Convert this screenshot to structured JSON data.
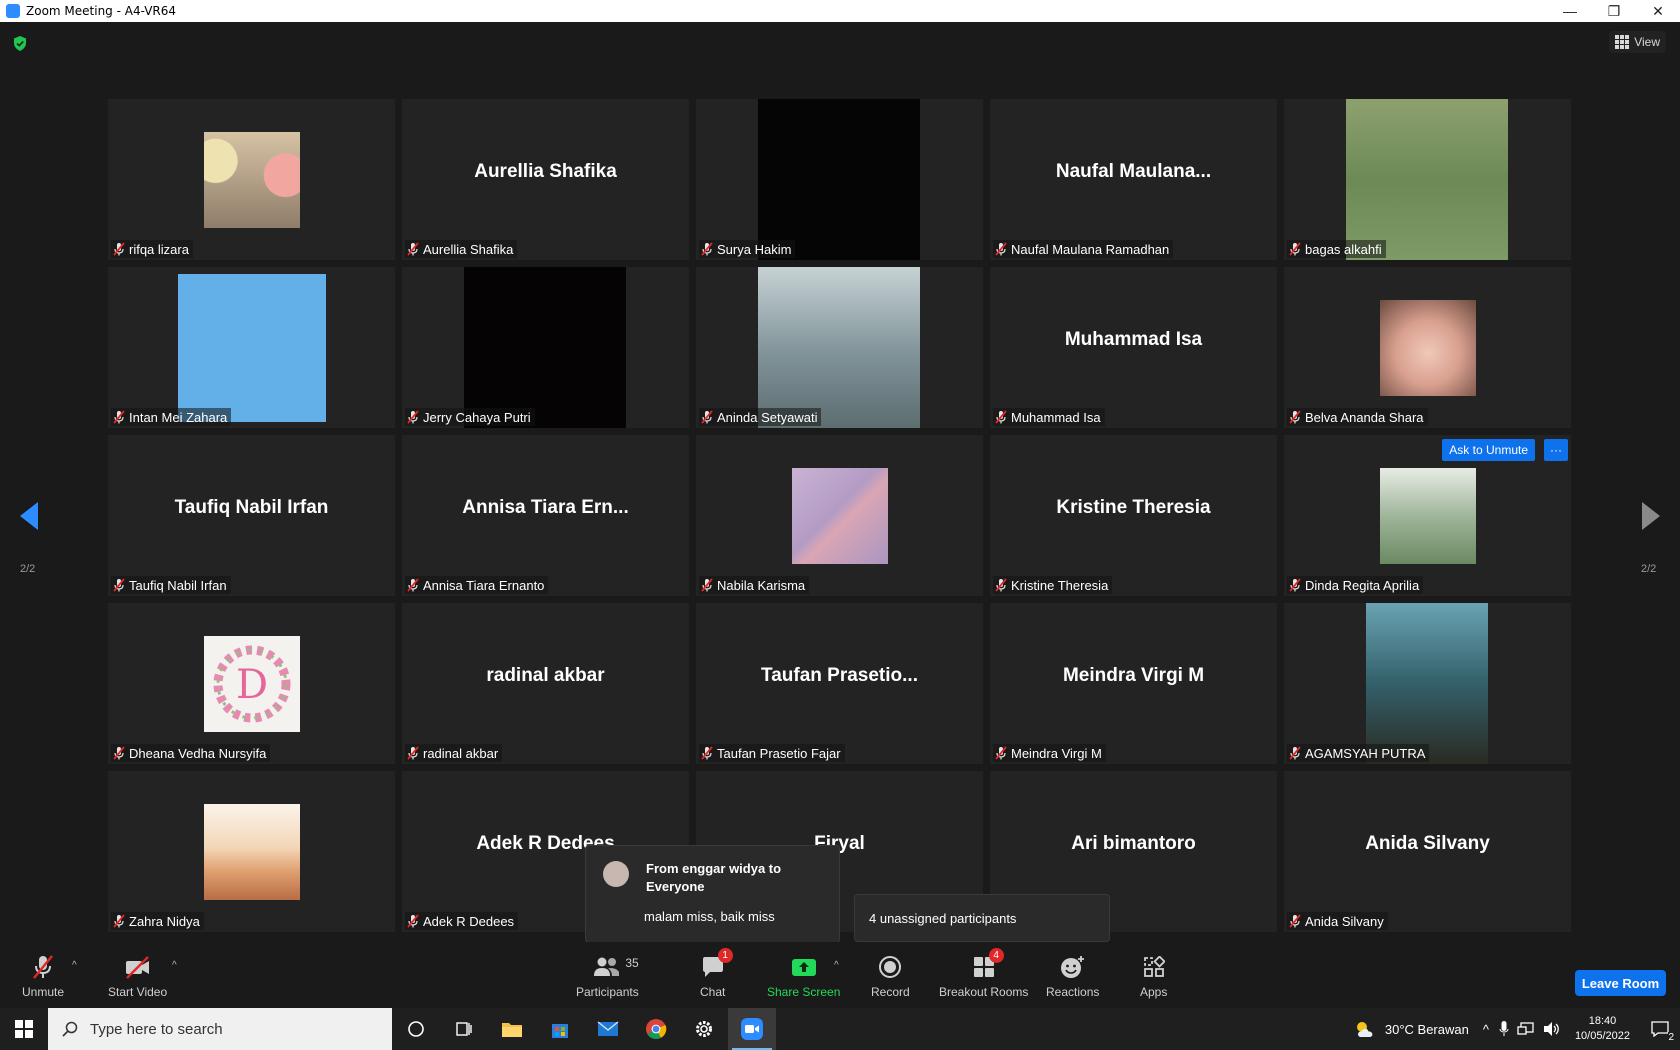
{
  "window": {
    "title": "Zoom Meeting - A4-VR64"
  },
  "top_bar": {
    "view_label": "View"
  },
  "gallery": {
    "page_indicator_left": "2/2",
    "page_indicator_right": "2/2",
    "ask_to_unmute_label": "Ask to Unmute",
    "more_label": "···",
    "tiles": [
      {
        "name": "rifqa lizara",
        "display": "",
        "photo": "balloons-photo",
        "photo_color": "#c9a88f"
      },
      {
        "name": "Aurellia Shafika",
        "display": "Aurellia Shafika",
        "photo": "",
        "photo_color": ""
      },
      {
        "name": "Surya Hakim",
        "display": "",
        "photo": "black-video",
        "photo_color": "#050505"
      },
      {
        "name": "Naufal Maulana Ramadhan",
        "display": "Naufal  Maulana...",
        "photo": "",
        "photo_color": ""
      },
      {
        "name": "bagas alkahfi",
        "display": "",
        "photo": "football-field-video",
        "photo_color": "#6f8a5a"
      },
      {
        "name": "Intan Mei Zahara",
        "display": "",
        "photo": "blue-square",
        "photo_color": "#63b0e8"
      },
      {
        "name": "Jerry Cahaya Putri",
        "display": "",
        "photo": "black-video",
        "photo_color": "#050303"
      },
      {
        "name": "Aninda Setyawati",
        "display": "",
        "photo": "stairs-photo",
        "photo_color": "#8fa4aa"
      },
      {
        "name": "Muhammad Isa",
        "display": "Muhammad Isa",
        "photo": "",
        "photo_color": ""
      },
      {
        "name": "Belva Ananda Shara",
        "display": "",
        "photo": "portrait-photo",
        "photo_color": "#d8a59a"
      },
      {
        "name": "Taufiq Nabil Irfan",
        "display": "Taufiq Nabil Irfan",
        "photo": "",
        "photo_color": ""
      },
      {
        "name": "Annisa Tiara Ernanto",
        "display": "Annisa  Tiara  Ern...",
        "photo": "",
        "photo_color": ""
      },
      {
        "name": "Nabila Karisma",
        "display": "",
        "photo": "rainbow-sky-photo",
        "photo_color": "#b79ec0"
      },
      {
        "name": "Kristine Theresia",
        "display": "Kristine Theresia",
        "photo": "",
        "photo_color": ""
      },
      {
        "name": "Dinda Regita Aprilia",
        "display": "",
        "photo": "garden-photo",
        "photo_color": "#9fb59a"
      },
      {
        "name": "Dheana Vedha Nursyifa",
        "display": "",
        "photo": "letter-d-wreath",
        "photo_color": "#f4f2ee"
      },
      {
        "name": "radinal akbar",
        "display": "radinal akbar",
        "photo": "",
        "photo_color": ""
      },
      {
        "name": "Taufan Prasetio Fajar",
        "display": "Taufan  Prasetio...",
        "photo": "",
        "photo_color": ""
      },
      {
        "name": "Meindra Virgi M",
        "display": "Meindra Virgi M",
        "photo": "",
        "photo_color": ""
      },
      {
        "name": "AGAMSYAH PUTRA",
        "display": "",
        "photo": "city-jacket-photo",
        "photo_color": "#3f6c78"
      },
      {
        "name": "Zahra Nidya",
        "display": "",
        "photo": "desert-sunset-art",
        "photo_color": "#e2b48e"
      },
      {
        "name": "Adek R Dedees",
        "display": "Adek R Dedees",
        "photo": "",
        "photo_color": ""
      },
      {
        "name": "",
        "display": "Firyal",
        "photo": "",
        "photo_color": ""
      },
      {
        "name": "",
        "display": "Ari bimantoro",
        "photo": "",
        "photo_color": ""
      },
      {
        "name": "Anida Silvany",
        "display": "Anida Silvany",
        "photo": "",
        "photo_color": ""
      }
    ]
  },
  "chat_popup": {
    "from": "From enggar widya to Everyone",
    "message": "malam miss, baik miss"
  },
  "breakout_popup": {
    "text": "4 unassigned participants"
  },
  "toolbar": {
    "unmute": "Unmute",
    "start_video": "Start Video",
    "participants": "Participants",
    "participants_count": "35",
    "chat": "Chat",
    "chat_badge": "1",
    "share_screen": "Share Screen",
    "record": "Record",
    "breakout_rooms": "Breakout Rooms",
    "breakout_badge": "4",
    "reactions": "Reactions",
    "apps": "Apps",
    "leave_room": "Leave Room",
    "share_color": "#23d959",
    "accent": "#0e72ed"
  },
  "taskbar": {
    "search_placeholder": "Type here to search",
    "weather": "30°C  Berawan",
    "time": "18:40",
    "date": "10/05/2022",
    "notification_count": "2"
  }
}
